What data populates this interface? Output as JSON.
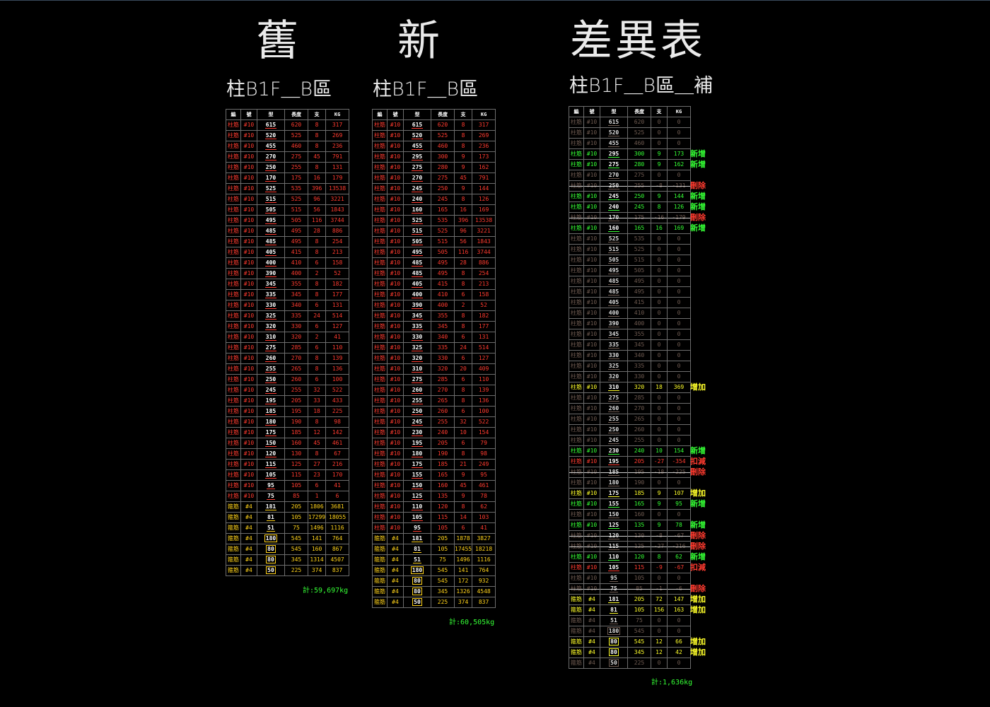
{
  "titles": {
    "old": "舊",
    "new": "新",
    "diff": "差異表"
  },
  "subtitles": {
    "old": "柱B1F＿B區",
    "new": "柱B1F＿B區",
    "diff": "柱B1F＿B區＿補"
  },
  "headers": [
    "編",
    "號",
    "型",
    "長度",
    "支",
    "KG"
  ],
  "colors": {
    "red": "#ff3b2f",
    "yellow": "#ffd21a",
    "green": "#35ff35",
    "bright_yellow": "#ffff2a",
    "dim": "#6e5a50"
  },
  "status_labels": {
    "add": "新增",
    "increase": "增加",
    "delete": "刪除",
    "deduct": "扣減"
  },
  "old_table": {
    "total": "計:59,697kg",
    "rows": [
      [
        "柱筋",
        "#10",
        "615",
        "620",
        "8",
        "317",
        "r"
      ],
      [
        "柱筋",
        "#10",
        "520",
        "525",
        "8",
        "269",
        "r"
      ],
      [
        "柱筋",
        "#10",
        "455",
        "460",
        "8",
        "236",
        "r"
      ],
      [
        "柱筋",
        "#10",
        "270",
        "275",
        "45",
        "791",
        "r"
      ],
      [
        "柱筋",
        "#10",
        "250",
        "255",
        "8",
        "131",
        "r"
      ],
      [
        "柱筋",
        "#10",
        "170",
        "175",
        "16",
        "179",
        "r"
      ],
      [
        "柱筋",
        "#10",
        "525",
        "535",
        "396",
        "13538",
        "r"
      ],
      [
        "柱筋",
        "#10",
        "515",
        "525",
        "96",
        "3221",
        "r"
      ],
      [
        "柱筋",
        "#10",
        "505",
        "515",
        "56",
        "1843",
        "r"
      ],
      [
        "柱筋",
        "#10",
        "495",
        "505",
        "116",
        "3744",
        "r"
      ],
      [
        "柱筋",
        "#10",
        "485",
        "495",
        "28",
        "886",
        "r"
      ],
      [
        "柱筋",
        "#10",
        "485",
        "495",
        "8",
        "254",
        "r"
      ],
      [
        "柱筋",
        "#10",
        "405",
        "415",
        "8",
        "213",
        "r"
      ],
      [
        "柱筋",
        "#10",
        "400",
        "410",
        "6",
        "158",
        "r"
      ],
      [
        "柱筋",
        "#10",
        "390",
        "400",
        "2",
        "52",
        "r"
      ],
      [
        "柱筋",
        "#10",
        "345",
        "355",
        "8",
        "182",
        "r"
      ],
      [
        "柱筋",
        "#10",
        "335",
        "345",
        "8",
        "177",
        "r"
      ],
      [
        "柱筋",
        "#10",
        "330",
        "340",
        "6",
        "131",
        "r"
      ],
      [
        "柱筋",
        "#10",
        "325",
        "335",
        "24",
        "514",
        "r"
      ],
      [
        "柱筋",
        "#10",
        "320",
        "330",
        "6",
        "127",
        "r"
      ],
      [
        "柱筋",
        "#10",
        "310",
        "320",
        "2",
        "41",
        "r"
      ],
      [
        "柱筋",
        "#10",
        "275",
        "285",
        "6",
        "110",
        "r"
      ],
      [
        "柱筋",
        "#10",
        "260",
        "270",
        "8",
        "139",
        "r"
      ],
      [
        "柱筋",
        "#10",
        "255",
        "265",
        "8",
        "136",
        "r"
      ],
      [
        "柱筋",
        "#10",
        "250",
        "260",
        "6",
        "100",
        "r"
      ],
      [
        "柱筋",
        "#10",
        "245",
        "255",
        "32",
        "522",
        "r"
      ],
      [
        "柱筋",
        "#10",
        "195",
        "205",
        "33",
        "433",
        "r"
      ],
      [
        "柱筋",
        "#10",
        "185",
        "195",
        "18",
        "225",
        "r"
      ],
      [
        "柱筋",
        "#10",
        "180",
        "190",
        "8",
        "98",
        "r"
      ],
      [
        "柱筋",
        "#10",
        "175",
        "185",
        "12",
        "142",
        "r"
      ],
      [
        "柱筋",
        "#10",
        "150",
        "160",
        "45",
        "461",
        "r"
      ],
      [
        "柱筋",
        "#10",
        "120",
        "130",
        "8",
        "67",
        "r"
      ],
      [
        "柱筋",
        "#10",
        "115",
        "125",
        "27",
        "216",
        "r"
      ],
      [
        "柱筋",
        "#10",
        "105",
        "115",
        "23",
        "170",
        "r"
      ],
      [
        "柱筋",
        "#10",
        "95",
        "105",
        "6",
        "41",
        "r"
      ],
      [
        "柱筋",
        "#10",
        "75",
        "85",
        "1",
        "6",
        "r"
      ],
      [
        "箍筋",
        "#4",
        "181",
        "205",
        "1806",
        "3681",
        "y"
      ],
      [
        "箍筋",
        "#4",
        "81",
        "105",
        "17299",
        "18055",
        "y"
      ],
      [
        "箍筋",
        "#4",
        "51",
        "75",
        "1496",
        "1116",
        "y"
      ],
      [
        "箍筋",
        "#4",
        "180",
        "545",
        "141",
        "764",
        "y"
      ],
      [
        "箍筋",
        "#4",
        "80",
        "545",
        "160",
        "867",
        "y"
      ],
      [
        "箍筋",
        "#4",
        "80",
        "345",
        "1314",
        "4507",
        "y"
      ],
      [
        "箍筋",
        "#4",
        "50",
        "225",
        "374",
        "837",
        "y"
      ]
    ]
  },
  "new_table": {
    "total": "計:60,505kg",
    "rows": [
      [
        "柱筋",
        "#10",
        "615",
        "620",
        "8",
        "317",
        "r"
      ],
      [
        "柱筋",
        "#10",
        "520",
        "525",
        "8",
        "269",
        "r"
      ],
      [
        "柱筋",
        "#10",
        "455",
        "460",
        "8",
        "236",
        "r"
      ],
      [
        "柱筋",
        "#10",
        "295",
        "300",
        "9",
        "173",
        "r"
      ],
      [
        "柱筋",
        "#10",
        "275",
        "280",
        "9",
        "162",
        "r"
      ],
      [
        "柱筋",
        "#10",
        "270",
        "275",
        "45",
        "791",
        "r"
      ],
      [
        "柱筋",
        "#10",
        "245",
        "250",
        "9",
        "144",
        "r"
      ],
      [
        "柱筋",
        "#10",
        "240",
        "245",
        "8",
        "126",
        "r"
      ],
      [
        "柱筋",
        "#10",
        "160",
        "165",
        "16",
        "169",
        "r"
      ],
      [
        "柱筋",
        "#10",
        "525",
        "535",
        "396",
        "13538",
        "r"
      ],
      [
        "柱筋",
        "#10",
        "515",
        "525",
        "96",
        "3221",
        "r"
      ],
      [
        "柱筋",
        "#10",
        "505",
        "515",
        "56",
        "1843",
        "r"
      ],
      [
        "柱筋",
        "#10",
        "495",
        "505",
        "116",
        "3744",
        "r"
      ],
      [
        "柱筋",
        "#10",
        "485",
        "495",
        "28",
        "886",
        "r"
      ],
      [
        "柱筋",
        "#10",
        "485",
        "495",
        "8",
        "254",
        "r"
      ],
      [
        "柱筋",
        "#10",
        "405",
        "415",
        "8",
        "213",
        "r"
      ],
      [
        "柱筋",
        "#10",
        "400",
        "410",
        "6",
        "158",
        "r"
      ],
      [
        "柱筋",
        "#10",
        "390",
        "400",
        "2",
        "52",
        "r"
      ],
      [
        "柱筋",
        "#10",
        "345",
        "355",
        "8",
        "182",
        "r"
      ],
      [
        "柱筋",
        "#10",
        "335",
        "345",
        "8",
        "177",
        "r"
      ],
      [
        "柱筋",
        "#10",
        "330",
        "340",
        "6",
        "131",
        "r"
      ],
      [
        "柱筋",
        "#10",
        "325",
        "335",
        "24",
        "514",
        "r"
      ],
      [
        "柱筋",
        "#10",
        "320",
        "330",
        "6",
        "127",
        "r"
      ],
      [
        "柱筋",
        "#10",
        "310",
        "320",
        "20",
        "409",
        "r"
      ],
      [
        "柱筋",
        "#10",
        "275",
        "285",
        "6",
        "110",
        "r"
      ],
      [
        "柱筋",
        "#10",
        "260",
        "270",
        "8",
        "139",
        "r"
      ],
      [
        "柱筋",
        "#10",
        "255",
        "265",
        "8",
        "136",
        "r"
      ],
      [
        "柱筋",
        "#10",
        "250",
        "260",
        "6",
        "100",
        "r"
      ],
      [
        "柱筋",
        "#10",
        "245",
        "255",
        "32",
        "522",
        "r"
      ],
      [
        "柱筋",
        "#10",
        "230",
        "240",
        "10",
        "154",
        "r"
      ],
      [
        "柱筋",
        "#10",
        "195",
        "205",
        "6",
        "79",
        "r"
      ],
      [
        "柱筋",
        "#10",
        "180",
        "190",
        "8",
        "98",
        "r"
      ],
      [
        "柱筋",
        "#10",
        "175",
        "185",
        "21",
        "249",
        "r"
      ],
      [
        "柱筋",
        "#10",
        "155",
        "165",
        "9",
        "95",
        "r"
      ],
      [
        "柱筋",
        "#10",
        "150",
        "160",
        "45",
        "461",
        "r"
      ],
      [
        "柱筋",
        "#10",
        "125",
        "135",
        "9",
        "78",
        "r"
      ],
      [
        "柱筋",
        "#10",
        "110",
        "120",
        "8",
        "62",
        "r"
      ],
      [
        "柱筋",
        "#10",
        "105",
        "115",
        "14",
        "103",
        "r"
      ],
      [
        "柱筋",
        "#10",
        "95",
        "105",
        "6",
        "41",
        "r"
      ],
      [
        "箍筋",
        "#4",
        "181",
        "205",
        "1878",
        "3827",
        "y"
      ],
      [
        "箍筋",
        "#4",
        "81",
        "105",
        "17455",
        "18218",
        "y"
      ],
      [
        "箍筋",
        "#4",
        "51",
        "75",
        "1496",
        "1116",
        "y"
      ],
      [
        "箍筋",
        "#4",
        "180",
        "545",
        "141",
        "764",
        "y"
      ],
      [
        "箍筋",
        "#4",
        "80",
        "545",
        "172",
        "932",
        "y"
      ],
      [
        "箍筋",
        "#4",
        "80",
        "345",
        "1326",
        "4548",
        "y"
      ],
      [
        "箍筋",
        "#4",
        "50",
        "225",
        "374",
        "837",
        "y"
      ]
    ]
  },
  "diff_table": {
    "total": "計:1,636kg",
    "rows": [
      [
        "柱筋",
        "#10",
        "615",
        "620",
        "0",
        "0",
        "d",
        ""
      ],
      [
        "柱筋",
        "#10",
        "520",
        "525",
        "0",
        "0",
        "d",
        ""
      ],
      [
        "柱筋",
        "#10",
        "455",
        "460",
        "0",
        "0",
        "d",
        ""
      ],
      [
        "柱筋",
        "#10",
        "295",
        "300",
        "9",
        "173",
        "g",
        "add"
      ],
      [
        "柱筋",
        "#10",
        "275",
        "280",
        "9",
        "162",
        "g",
        "add"
      ],
      [
        "柱筋",
        "#10",
        "270",
        "275",
        "0",
        "0",
        "d",
        ""
      ],
      [
        "柱筋",
        "#10",
        "250",
        "255",
        "-8",
        "-131",
        "x",
        "delete"
      ],
      [
        "柱筋",
        "#10",
        "245",
        "250",
        "9",
        "144",
        "g",
        "add"
      ],
      [
        "柱筋",
        "#10",
        "240",
        "245",
        "8",
        "126",
        "g",
        "add"
      ],
      [
        "柱筋",
        "#10",
        "170",
        "175",
        "-16",
        "-179",
        "x",
        "delete"
      ],
      [
        "柱筋",
        "#10",
        "160",
        "165",
        "16",
        "169",
        "g",
        "add"
      ],
      [
        "柱筋",
        "#10",
        "525",
        "535",
        "0",
        "0",
        "d",
        ""
      ],
      [
        "柱筋",
        "#10",
        "515",
        "525",
        "0",
        "0",
        "d",
        ""
      ],
      [
        "柱筋",
        "#10",
        "505",
        "515",
        "0",
        "0",
        "d",
        ""
      ],
      [
        "柱筋",
        "#10",
        "495",
        "505",
        "0",
        "0",
        "d",
        ""
      ],
      [
        "柱筋",
        "#10",
        "485",
        "495",
        "0",
        "0",
        "d",
        ""
      ],
      [
        "柱筋",
        "#10",
        "485",
        "495",
        "0",
        "0",
        "d",
        ""
      ],
      [
        "柱筋",
        "#10",
        "405",
        "415",
        "0",
        "0",
        "d",
        ""
      ],
      [
        "柱筋",
        "#10",
        "400",
        "410",
        "0",
        "0",
        "d",
        ""
      ],
      [
        "柱筋",
        "#10",
        "390",
        "400",
        "0",
        "0",
        "d",
        ""
      ],
      [
        "柱筋",
        "#10",
        "345",
        "355",
        "0",
        "0",
        "d",
        ""
      ],
      [
        "柱筋",
        "#10",
        "335",
        "345",
        "0",
        "0",
        "d",
        ""
      ],
      [
        "柱筋",
        "#10",
        "330",
        "340",
        "0",
        "0",
        "d",
        ""
      ],
      [
        "柱筋",
        "#10",
        "325",
        "335",
        "0",
        "0",
        "d",
        ""
      ],
      [
        "柱筋",
        "#10",
        "320",
        "330",
        "0",
        "0",
        "d",
        ""
      ],
      [
        "柱筋",
        "#10",
        "310",
        "320",
        "18",
        "369",
        "b",
        "increase"
      ],
      [
        "柱筋",
        "#10",
        "275",
        "285",
        "0",
        "0",
        "d",
        ""
      ],
      [
        "柱筋",
        "#10",
        "260",
        "270",
        "0",
        "0",
        "d",
        ""
      ],
      [
        "柱筋",
        "#10",
        "255",
        "265",
        "0",
        "0",
        "d",
        ""
      ],
      [
        "柱筋",
        "#10",
        "250",
        "260",
        "0",
        "0",
        "d",
        ""
      ],
      [
        "柱筋",
        "#10",
        "245",
        "255",
        "0",
        "0",
        "d",
        ""
      ],
      [
        "柱筋",
        "#10",
        "230",
        "240",
        "10",
        "154",
        "g",
        "add"
      ],
      [
        "柱筋",
        "#10",
        "195",
        "205",
        "-27",
        "-354",
        "rd",
        "deduct"
      ],
      [
        "柱筋",
        "#10",
        "185",
        "195",
        "-18",
        "-225",
        "x",
        "delete"
      ],
      [
        "柱筋",
        "#10",
        "180",
        "190",
        "0",
        "0",
        "d",
        ""
      ],
      [
        "柱筋",
        "#10",
        "175",
        "185",
        "9",
        "107",
        "b",
        "increase"
      ],
      [
        "柱筋",
        "#10",
        "155",
        "165",
        "9",
        "95",
        "g",
        "add"
      ],
      [
        "柱筋",
        "#10",
        "150",
        "160",
        "0",
        "0",
        "d",
        ""
      ],
      [
        "柱筋",
        "#10",
        "125",
        "135",
        "9",
        "78",
        "g",
        "add"
      ],
      [
        "柱筋",
        "#10",
        "120",
        "130",
        "-8",
        "-67",
        "x",
        "delete"
      ],
      [
        "柱筋",
        "#10",
        "115",
        "125",
        "-27",
        "-216",
        "x",
        "delete"
      ],
      [
        "柱筋",
        "#10",
        "110",
        "120",
        "8",
        "62",
        "g",
        "add"
      ],
      [
        "柱筋",
        "#10",
        "105",
        "115",
        "-9",
        "-67",
        "rd",
        "deduct"
      ],
      [
        "柱筋",
        "#10",
        "95",
        "105",
        "0",
        "0",
        "d",
        ""
      ],
      [
        "柱筋",
        "#10",
        "75",
        "85",
        "-1",
        "-6",
        "x",
        "delete"
      ],
      [
        "箍筋",
        "#4",
        "181",
        "205",
        "72",
        "147",
        "b",
        "increase"
      ],
      [
        "箍筋",
        "#4",
        "81",
        "105",
        "156",
        "163",
        "b",
        "increase"
      ],
      [
        "箍筋",
        "#4",
        "51",
        "75",
        "0",
        "0",
        "d",
        ""
      ],
      [
        "箍筋",
        "#4",
        "180",
        "545",
        "0",
        "0",
        "d",
        ""
      ],
      [
        "箍筋",
        "#4",
        "80",
        "545",
        "12",
        "66",
        "b",
        "increase"
      ],
      [
        "箍筋",
        "#4",
        "80",
        "345",
        "12",
        "42",
        "b",
        "increase"
      ],
      [
        "箍筋",
        "#4",
        "50",
        "225",
        "0",
        "0",
        "d",
        ""
      ]
    ]
  }
}
